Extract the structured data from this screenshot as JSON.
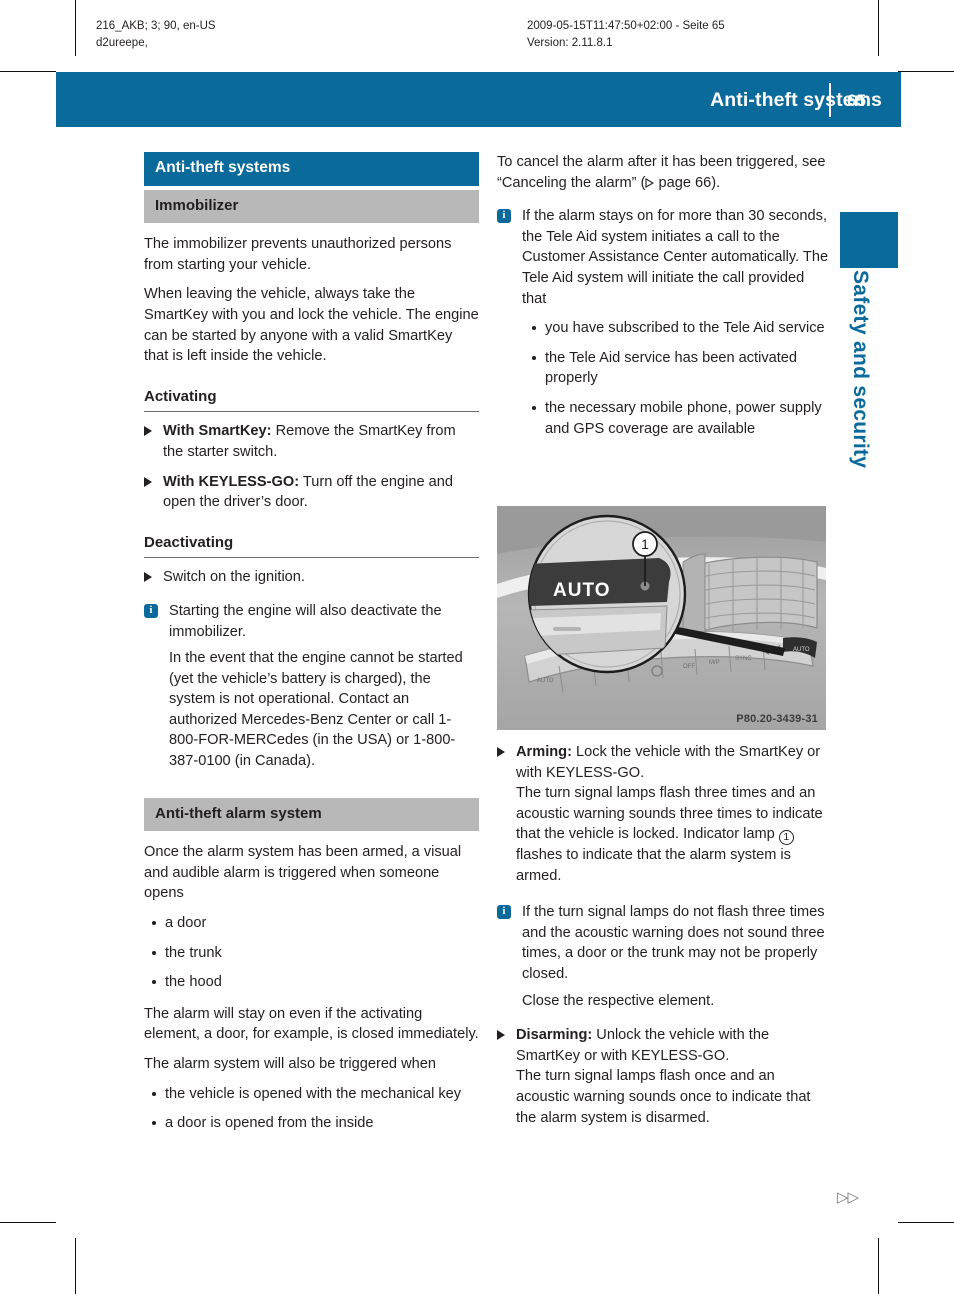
{
  "print_meta": {
    "left": "216_AKB; 3; 90, en-US\nd2ureepe,",
    "right": "2009-05-15T11:47:50+02:00 - Seite 65\nVersion: 2.11.8.1"
  },
  "header": {
    "title": "Anti-theft systems",
    "page_number": "65"
  },
  "thumb_tab": {
    "label": "Safety and security"
  },
  "colors": {
    "accent_blue": "#0a6a9b",
    "heading_grey": "#b8b8b8",
    "text": "#231f20"
  },
  "left_column": {
    "section_title": "Anti-theft systems",
    "subsection_title": "Immobilizer",
    "intro_paragraphs": [
      "The immobilizer prevents unauthorized persons from starting your vehicle.",
      "When leaving the vehicle, always take the SmartKey with you and lock the vehicle. The engine can be started by anyone with a valid SmartKey that is left inside the vehicle."
    ],
    "activating": {
      "heading": "Activating",
      "steps": [
        {
          "lead": "With SmartKey:",
          "text": " Remove the SmartKey from the starter switch."
        },
        {
          "lead": "With KEYLESS-GO:",
          "text": " Turn off the engine and open the driver’s door."
        }
      ]
    },
    "deactivating": {
      "heading": "Deactivating",
      "steps": [
        {
          "lead": "",
          "text": "Switch on the ignition."
        }
      ],
      "note": [
        "Starting the engine will also deactivate the immobilizer.",
        "In the event that the engine cannot be started (yet the vehicle’s battery is charged), the system is not operational. Contact an authorized Mercedes-Benz Center or call 1-800-FOR-MERCedes (in the USA) or 1-800-387-0100 (in Canada)."
      ]
    },
    "alarm_system": {
      "heading": "Anti-theft alarm system",
      "intro": "Once the alarm system has been armed, a visual and audible alarm is triggered when someone opens",
      "bullets_1": [
        "a door",
        "the trunk",
        "the hood"
      ],
      "middle_paragraph": "The alarm will stay on even if the activating element, a door, for example, is closed immediately.",
      "also_triggered_intro": "The alarm system will also be triggered when",
      "bullets_2": [
        "the vehicle is opened with the mechanical key",
        "a door is opened from the inside"
      ]
    }
  },
  "right_column": {
    "cancel_paragraph_part1": "To cancel the alarm after it has been triggered, see “Canceling the alarm” (",
    "cancel_page_ref": " page 66).",
    "tele_aid_note": {
      "text": "If the alarm stays on for more than 30 seconds, the Tele Aid system initiates a call to the Customer Assistance Center automatically. The Tele Aid system will initiate the call provided that",
      "bullets": [
        "you have subscribed to the Tele Aid service",
        "the Tele Aid service has been activated properly",
        "the necessary mobile phone, power supply and GPS coverage are available"
      ]
    },
    "figure": {
      "callout_number": "1",
      "display_text": "AUTO",
      "code": "P80.20-3439-31"
    },
    "arming": {
      "lead": "Arming:",
      "text_part1": " Lock the vehicle with the SmartKey or with KEYLESS-GO.",
      "text_part2": "The turn signal lamps flash three times and an acoustic warning sounds three times to indicate that the vehicle is locked. Indicator lamp ",
      "callout": "1",
      "text_part3": " flashes to indicate that the alarm system is armed."
    },
    "turn_signal_note": [
      "If the turn signal lamps do not flash three times and the acoustic warning does not sound three times, a door or the trunk may not be properly closed.",
      "Close the respective element."
    ],
    "disarming": {
      "lead": "Disarming:",
      "text_part1": " Unlock the vehicle with the SmartKey or with KEYLESS-GO.",
      "text_part2": "The turn signal lamps flash once and an acoustic warning sounds once to indicate that the alarm system is disarmed."
    }
  },
  "continuation_marker": "▷▷"
}
